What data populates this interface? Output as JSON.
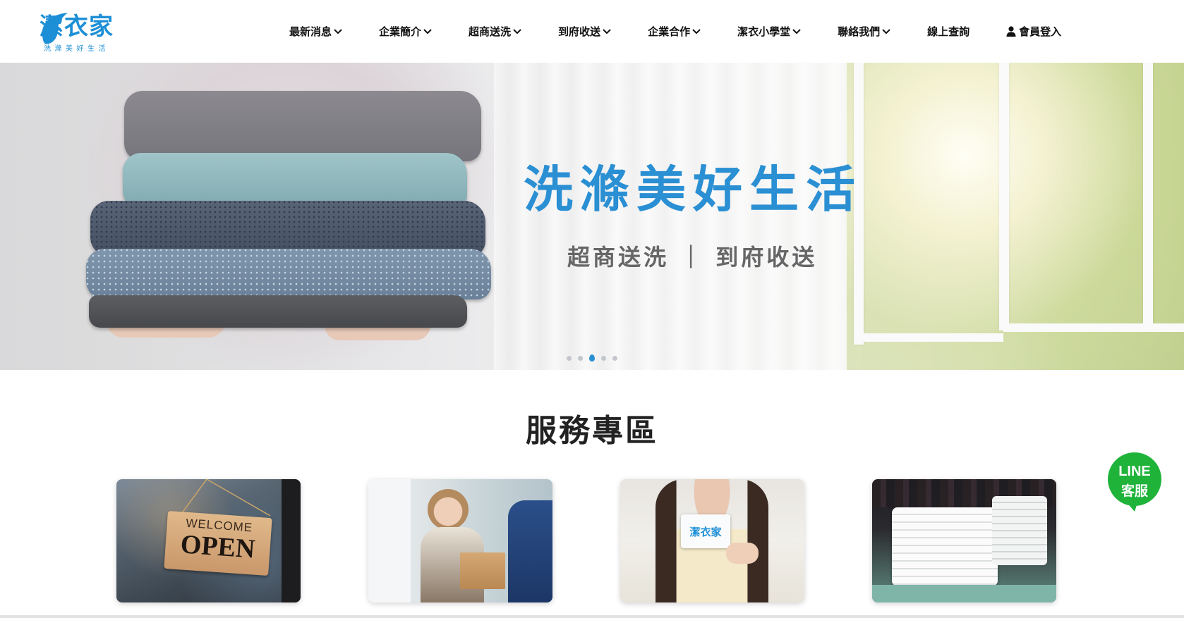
{
  "brand": {
    "logo_text": "潔衣家",
    "tagline": "洗滌美好生活",
    "color": "#1d8fd6"
  },
  "nav": {
    "items": [
      {
        "label": "最新消息",
        "has_dropdown": true
      },
      {
        "label": "企業簡介",
        "has_dropdown": true
      },
      {
        "label": "超商送洗",
        "has_dropdown": true
      },
      {
        "label": "到府收送",
        "has_dropdown": true
      },
      {
        "label": "企業合作",
        "has_dropdown": true
      },
      {
        "label": "潔衣小學堂",
        "has_dropdown": true
      },
      {
        "label": "聯絡我們",
        "has_dropdown": true
      },
      {
        "label": "線上查詢",
        "has_dropdown": false
      }
    ],
    "login_label": "會員登入",
    "login_icon": "user-icon",
    "dropdown_icon": "chevron-down-icon"
  },
  "hero": {
    "title": "洗滌美好生活",
    "subtitle": "超商送洗 ｜ 到府收送",
    "slide_count": 5,
    "active_slide": 3,
    "accent_color": "#2a8fd3"
  },
  "services": {
    "title": "服務專區",
    "cards": [
      {
        "sign_line1": "WELCOME",
        "sign_line2": "OPEN"
      },
      {},
      {
        "card_logo": "潔衣家"
      },
      {}
    ]
  },
  "line_badge": {
    "line1": "LINE",
    "line2": "客服",
    "color": "#1fb33a"
  }
}
